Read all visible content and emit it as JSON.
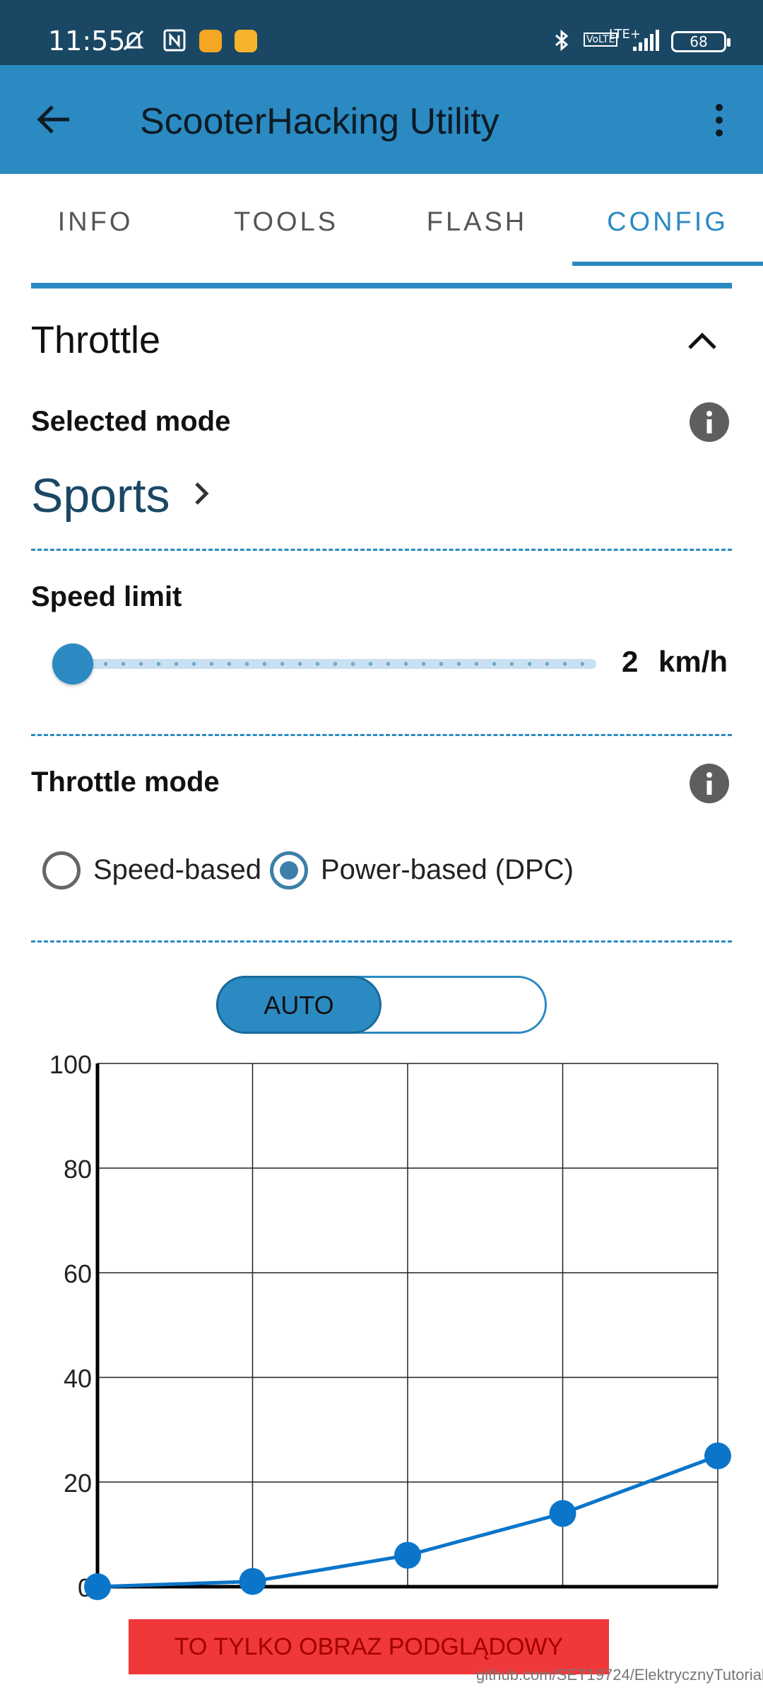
{
  "status_bar": {
    "time": "11:55",
    "network": "LTE+",
    "volte": "VoLTE",
    "battery": "68",
    "icons": [
      "mute-bell-icon",
      "nfc-icon",
      "app-icon",
      "app-icon",
      "bluetooth-icon",
      "signal-icon"
    ]
  },
  "app_bar": {
    "title": "ScooterHacking Utility"
  },
  "tabs": [
    {
      "label": "INFO"
    },
    {
      "label": "TOOLS"
    },
    {
      "label": "FLASH"
    },
    {
      "label": "CONFIG",
      "active": true
    }
  ],
  "throttle": {
    "title": "Throttle",
    "selected_mode_label": "Selected mode",
    "selected_mode_value": "Sports",
    "speed_limit_label": "Speed limit",
    "speed_limit_value": "2",
    "speed_limit_unit": "km/h",
    "throttle_mode_label": "Throttle mode",
    "options": [
      "Speed-based",
      "Power-based (DPC)"
    ],
    "selected_option": "Power-based (DPC)",
    "auto_label": "AUTO"
  },
  "colors": {
    "accent": "#2b8ac2",
    "dark_accent": "#1a4764",
    "chart_line": "#0a75c9"
  },
  "chart_data": {
    "type": "line",
    "x": [
      0,
      1,
      2,
      3,
      4
    ],
    "series": [
      {
        "values": [
          0,
          1,
          6,
          14,
          25
        ]
      }
    ],
    "yticks": [
      "0",
      "20",
      "40",
      "60",
      "80",
      "100"
    ],
    "ylim": [
      0,
      100
    ],
    "grid": true
  },
  "banner": {
    "text": "TO TYLKO OBRAZ PODGLĄDOWY",
    "credit": "github.com/SET19724/ElektrycznyTutorial"
  }
}
